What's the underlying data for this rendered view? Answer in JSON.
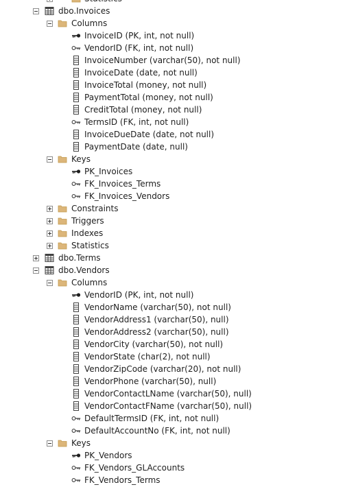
{
  "tree": [
    {
      "text": "Statistics",
      "level": 3,
      "icon": "folder-icon",
      "expander": "plus"
    },
    {
      "text": "dbo.Invoices",
      "level": 1,
      "icon": "table-icon",
      "expander": "minus"
    },
    {
      "text": "Columns",
      "level": 2,
      "icon": "folder-icon",
      "expander": "minus"
    },
    {
      "text": "InvoiceID (PK, int, not null)",
      "level": 3,
      "icon": "primary-key-icon"
    },
    {
      "text": "VendorID (FK, int, not null)",
      "level": 3,
      "icon": "foreign-key-icon"
    },
    {
      "text": "InvoiceNumber (varchar(50), not null)",
      "level": 3,
      "icon": "column-icon"
    },
    {
      "text": "InvoiceDate (date, not null)",
      "level": 3,
      "icon": "column-icon"
    },
    {
      "text": "InvoiceTotal (money, not null)",
      "level": 3,
      "icon": "column-icon"
    },
    {
      "text": "PaymentTotal (money, not null)",
      "level": 3,
      "icon": "column-icon"
    },
    {
      "text": "CreditTotal (money, not null)",
      "level": 3,
      "icon": "column-icon"
    },
    {
      "text": "TermsID (FK, int, not null)",
      "level": 3,
      "icon": "foreign-key-icon"
    },
    {
      "text": "InvoiceDueDate (date, not null)",
      "level": 3,
      "icon": "column-icon"
    },
    {
      "text": "PaymentDate (date, null)",
      "level": 3,
      "icon": "column-icon"
    },
    {
      "text": "Keys",
      "level": 2,
      "icon": "folder-icon",
      "expander": "minus"
    },
    {
      "text": "PK_Invoices",
      "level": 3,
      "icon": "primary-key-icon"
    },
    {
      "text": "FK_Invoices_Terms",
      "level": 3,
      "icon": "foreign-key-icon"
    },
    {
      "text": "FK_Invoices_Vendors",
      "level": 3,
      "icon": "foreign-key-icon"
    },
    {
      "text": "Constraints",
      "level": 2,
      "icon": "folder-icon",
      "expander": "plus"
    },
    {
      "text": "Triggers",
      "level": 2,
      "icon": "folder-icon",
      "expander": "plus"
    },
    {
      "text": "Indexes",
      "level": 2,
      "icon": "folder-icon",
      "expander": "plus"
    },
    {
      "text": "Statistics",
      "level": 2,
      "icon": "folder-icon",
      "expander": "plus"
    },
    {
      "text": "dbo.Terms",
      "level": 1,
      "icon": "table-icon",
      "expander": "plus"
    },
    {
      "text": "dbo.Vendors",
      "level": 1,
      "icon": "table-icon",
      "expander": "minus"
    },
    {
      "text": "Columns",
      "level": 2,
      "icon": "folder-icon",
      "expander": "minus"
    },
    {
      "text": "VendorID (PK, int, not null)",
      "level": 3,
      "icon": "primary-key-icon"
    },
    {
      "text": "VendorName (varchar(50), not null)",
      "level": 3,
      "icon": "column-icon"
    },
    {
      "text": "VendorAddress1 (varchar(50), null)",
      "level": 3,
      "icon": "column-icon"
    },
    {
      "text": "VendorAddress2 (varchar(50), null)",
      "level": 3,
      "icon": "column-icon"
    },
    {
      "text": "VendorCity (varchar(50), not null)",
      "level": 3,
      "icon": "column-icon"
    },
    {
      "text": "VendorState (char(2), not null)",
      "level": 3,
      "icon": "column-icon"
    },
    {
      "text": "VendorZipCode (varchar(20), not null)",
      "level": 3,
      "icon": "column-icon"
    },
    {
      "text": "VendorPhone (varchar(50), null)",
      "level": 3,
      "icon": "column-icon"
    },
    {
      "text": "VendorContactLName (varchar(50), null)",
      "level": 3,
      "icon": "column-icon"
    },
    {
      "text": "VendorContactFName (varchar(50), null)",
      "level": 3,
      "icon": "column-icon"
    },
    {
      "text": "DefaultTermsID (FK, int, not null)",
      "level": 3,
      "icon": "foreign-key-icon"
    },
    {
      "text": "DefaultAccountNo (FK, int, not null)",
      "level": 3,
      "icon": "foreign-key-icon"
    },
    {
      "text": "Keys",
      "level": 2,
      "icon": "folder-icon",
      "expander": "minus"
    },
    {
      "text": "PK_Vendors",
      "level": 3,
      "icon": "primary-key-icon"
    },
    {
      "text": "FK_Vendors_GLAccounts",
      "level": 3,
      "icon": "foreign-key-icon"
    },
    {
      "text": "FK_Vendors_Terms",
      "level": 3,
      "icon": "foreign-key-icon"
    }
  ]
}
